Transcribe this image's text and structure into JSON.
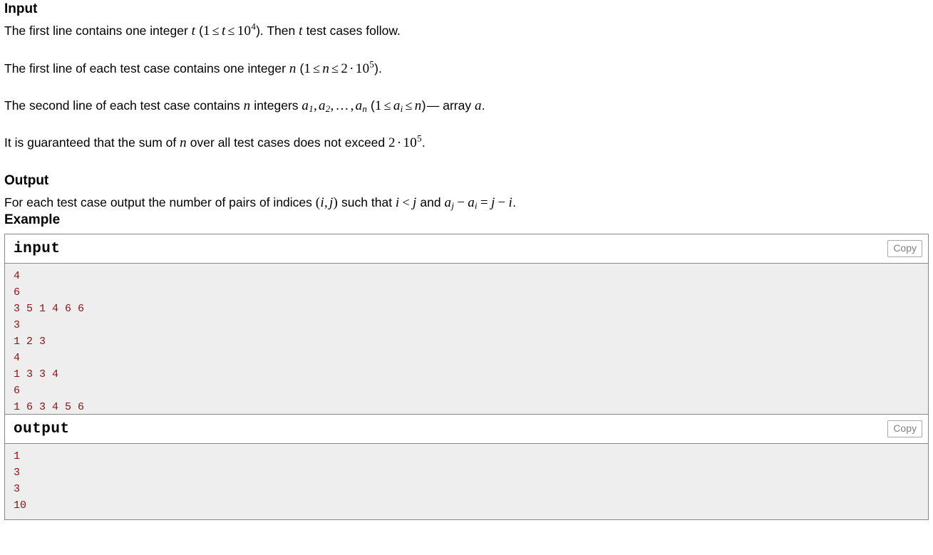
{
  "sections": {
    "input": {
      "title": "Input",
      "paragraphs": [
        "The first line contains one integer t (1 ≤ t ≤ 10^4). Then t test cases follow.",
        "The first line of each test case contains one integer n (1 ≤ n ≤ 2 · 10^5).",
        "The second line of each test case contains n integers a_1, a_2, …, a_n (1 ≤ a_i ≤ n) — array a.",
        "It is guaranteed that the sum of n over all test cases does not exceed 2 · 10^5."
      ]
    },
    "output": {
      "title": "Output",
      "paragraphs": [
        "For each test case output the number of pairs of indices (i, j) such that i < j and a_j − a_i = j − i."
      ]
    },
    "example": {
      "title": "Example",
      "input_label": "input",
      "output_label": "output",
      "copy_label": "Copy",
      "input_text": "4\n6\n3 5 1 4 6 6\n3\n1 2 3\n4\n1 3 3 4\n6\n1 6 3 4 5 6",
      "output_text": "1\n3\n3\n10",
      "test_count": 4,
      "test_cases": [
        {
          "n": 6,
          "array": [
            3,
            5,
            1,
            4,
            6,
            6
          ],
          "answer": 1
        },
        {
          "n": 3,
          "array": [
            1,
            2,
            3
          ],
          "answer": 3
        },
        {
          "n": 4,
          "array": [
            1,
            3,
            3,
            4
          ],
          "answer": 3
        },
        {
          "n": 6,
          "array": [
            1,
            6,
            3,
            4,
            5,
            6
          ],
          "answer": 10
        }
      ]
    }
  },
  "colors": {
    "sample_text": "#8a1215",
    "sample_bg": "#eeeeee",
    "border": "#888888",
    "copy_text": "#808080"
  }
}
